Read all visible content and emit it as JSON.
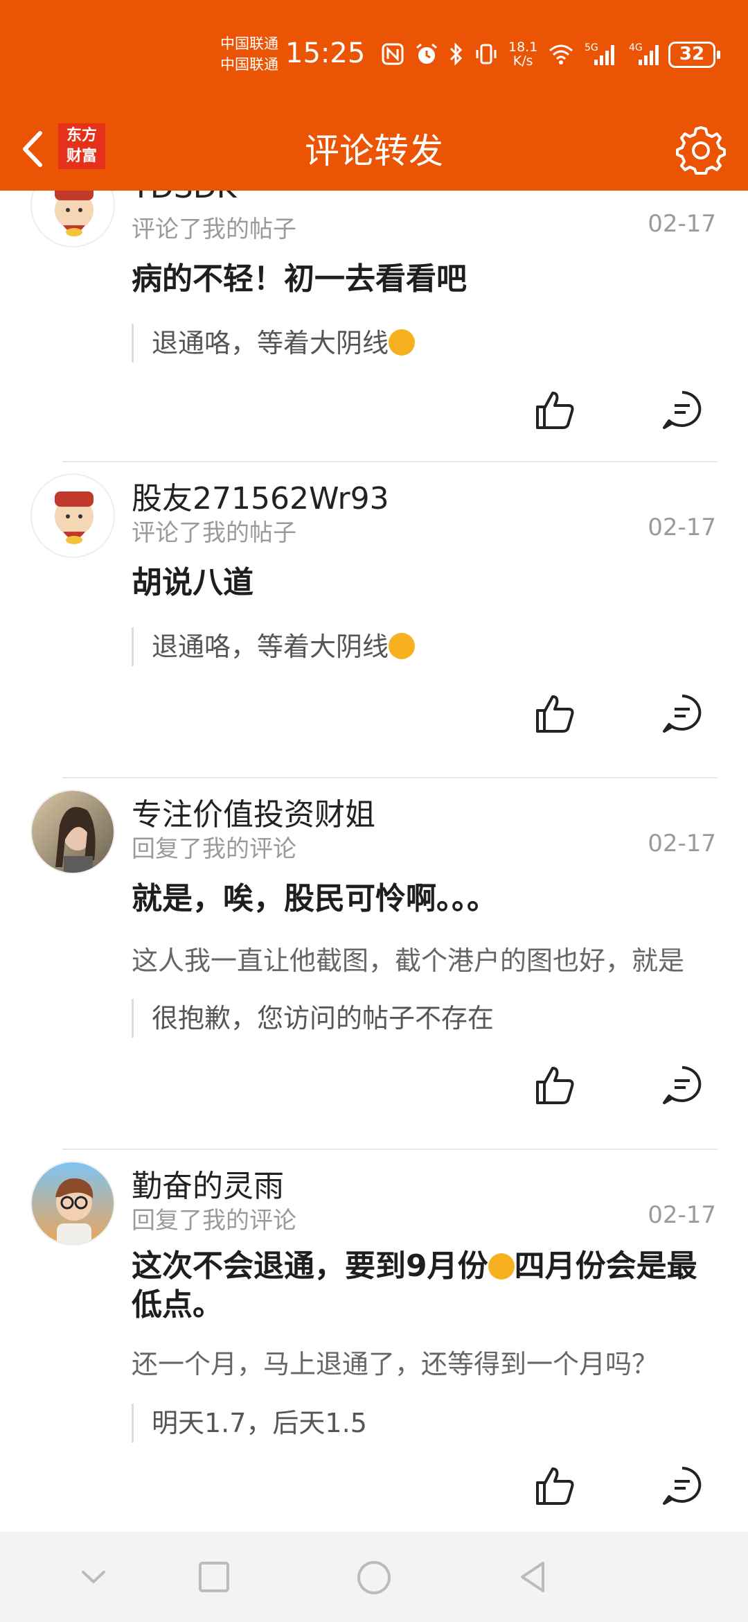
{
  "status_bar": {
    "carrier1": "中国联通",
    "carrier2": "中国联通",
    "time": "15:25",
    "speed_top": "18.1",
    "speed_unit": "K/s",
    "net1": "5G",
    "net2": "4G",
    "battery": "32"
  },
  "header": {
    "logo_line1": "东方",
    "logo_line2": "财富",
    "title": "评论转发"
  },
  "items": [
    {
      "username": "YDSDK",
      "action": "评论了我的帖子",
      "date": "02-17",
      "content": "病的不轻！初一去看看吧",
      "quote": "退通咯，等着大阴线"
    },
    {
      "username": "股友271562Wr93",
      "action": "评论了我的帖子",
      "date": "02-17",
      "content": "胡说八道",
      "quote": "退通咯，等着大阴线"
    },
    {
      "username": "专注价值投资财姐",
      "action": "回复了我的评论",
      "date": "02-17",
      "content": "就是，唉，股民可怜啊。。。",
      "sub": "这人我一直让他截图，截个港户的图也好，就是",
      "quote": "很抱歉，您访问的帖子不存在"
    },
    {
      "username": "勤奋的灵雨",
      "action": "回复了我的评论",
      "date": "02-17",
      "content_a": "这次不会退通，要到9月份",
      "content_b": "四月份会是最低点。",
      "sub": "还一个月，马上退通了，还等得到一个月吗？",
      "quote": "明天1.7，后天1.5"
    }
  ],
  "colors": {
    "brand": "#ea5404",
    "logo_red": "#e5301a"
  }
}
